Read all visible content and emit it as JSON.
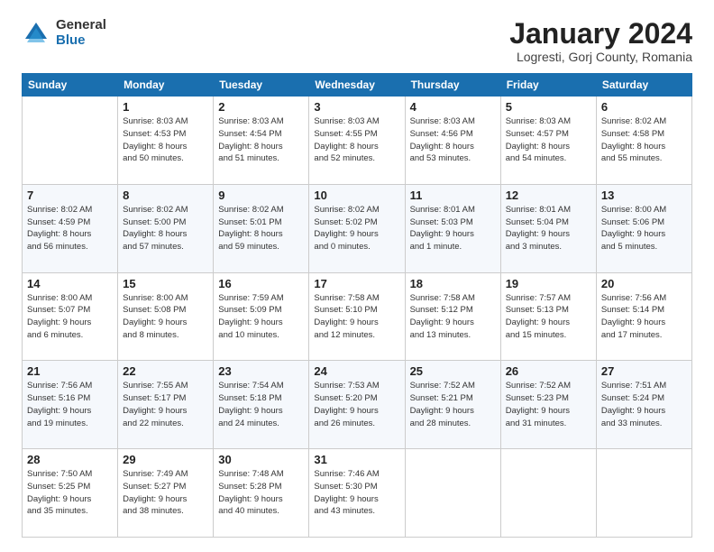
{
  "logo": {
    "general": "General",
    "blue": "Blue"
  },
  "header": {
    "month": "January 2024",
    "location": "Logresti, Gorj County, Romania"
  },
  "weekdays": [
    "Sunday",
    "Monday",
    "Tuesday",
    "Wednesday",
    "Thursday",
    "Friday",
    "Saturday"
  ],
  "weeks": [
    [
      {
        "day": "",
        "info": ""
      },
      {
        "day": "1",
        "info": "Sunrise: 8:03 AM\nSunset: 4:53 PM\nDaylight: 8 hours\nand 50 minutes."
      },
      {
        "day": "2",
        "info": "Sunrise: 8:03 AM\nSunset: 4:54 PM\nDaylight: 8 hours\nand 51 minutes."
      },
      {
        "day": "3",
        "info": "Sunrise: 8:03 AM\nSunset: 4:55 PM\nDaylight: 8 hours\nand 52 minutes."
      },
      {
        "day": "4",
        "info": "Sunrise: 8:03 AM\nSunset: 4:56 PM\nDaylight: 8 hours\nand 53 minutes."
      },
      {
        "day": "5",
        "info": "Sunrise: 8:03 AM\nSunset: 4:57 PM\nDaylight: 8 hours\nand 54 minutes."
      },
      {
        "day": "6",
        "info": "Sunrise: 8:02 AM\nSunset: 4:58 PM\nDaylight: 8 hours\nand 55 minutes."
      }
    ],
    [
      {
        "day": "7",
        "info": "Sunrise: 8:02 AM\nSunset: 4:59 PM\nDaylight: 8 hours\nand 56 minutes."
      },
      {
        "day": "8",
        "info": "Sunrise: 8:02 AM\nSunset: 5:00 PM\nDaylight: 8 hours\nand 57 minutes."
      },
      {
        "day": "9",
        "info": "Sunrise: 8:02 AM\nSunset: 5:01 PM\nDaylight: 8 hours\nand 59 minutes."
      },
      {
        "day": "10",
        "info": "Sunrise: 8:02 AM\nSunset: 5:02 PM\nDaylight: 9 hours\nand 0 minutes."
      },
      {
        "day": "11",
        "info": "Sunrise: 8:01 AM\nSunset: 5:03 PM\nDaylight: 9 hours\nand 1 minute."
      },
      {
        "day": "12",
        "info": "Sunrise: 8:01 AM\nSunset: 5:04 PM\nDaylight: 9 hours\nand 3 minutes."
      },
      {
        "day": "13",
        "info": "Sunrise: 8:00 AM\nSunset: 5:06 PM\nDaylight: 9 hours\nand 5 minutes."
      }
    ],
    [
      {
        "day": "14",
        "info": "Sunrise: 8:00 AM\nSunset: 5:07 PM\nDaylight: 9 hours\nand 6 minutes."
      },
      {
        "day": "15",
        "info": "Sunrise: 8:00 AM\nSunset: 5:08 PM\nDaylight: 9 hours\nand 8 minutes."
      },
      {
        "day": "16",
        "info": "Sunrise: 7:59 AM\nSunset: 5:09 PM\nDaylight: 9 hours\nand 10 minutes."
      },
      {
        "day": "17",
        "info": "Sunrise: 7:58 AM\nSunset: 5:10 PM\nDaylight: 9 hours\nand 12 minutes."
      },
      {
        "day": "18",
        "info": "Sunrise: 7:58 AM\nSunset: 5:12 PM\nDaylight: 9 hours\nand 13 minutes."
      },
      {
        "day": "19",
        "info": "Sunrise: 7:57 AM\nSunset: 5:13 PM\nDaylight: 9 hours\nand 15 minutes."
      },
      {
        "day": "20",
        "info": "Sunrise: 7:56 AM\nSunset: 5:14 PM\nDaylight: 9 hours\nand 17 minutes."
      }
    ],
    [
      {
        "day": "21",
        "info": "Sunrise: 7:56 AM\nSunset: 5:16 PM\nDaylight: 9 hours\nand 19 minutes."
      },
      {
        "day": "22",
        "info": "Sunrise: 7:55 AM\nSunset: 5:17 PM\nDaylight: 9 hours\nand 22 minutes."
      },
      {
        "day": "23",
        "info": "Sunrise: 7:54 AM\nSunset: 5:18 PM\nDaylight: 9 hours\nand 24 minutes."
      },
      {
        "day": "24",
        "info": "Sunrise: 7:53 AM\nSunset: 5:20 PM\nDaylight: 9 hours\nand 26 minutes."
      },
      {
        "day": "25",
        "info": "Sunrise: 7:52 AM\nSunset: 5:21 PM\nDaylight: 9 hours\nand 28 minutes."
      },
      {
        "day": "26",
        "info": "Sunrise: 7:52 AM\nSunset: 5:23 PM\nDaylight: 9 hours\nand 31 minutes."
      },
      {
        "day": "27",
        "info": "Sunrise: 7:51 AM\nSunset: 5:24 PM\nDaylight: 9 hours\nand 33 minutes."
      }
    ],
    [
      {
        "day": "28",
        "info": "Sunrise: 7:50 AM\nSunset: 5:25 PM\nDaylight: 9 hours\nand 35 minutes."
      },
      {
        "day": "29",
        "info": "Sunrise: 7:49 AM\nSunset: 5:27 PM\nDaylight: 9 hours\nand 38 minutes."
      },
      {
        "day": "30",
        "info": "Sunrise: 7:48 AM\nSunset: 5:28 PM\nDaylight: 9 hours\nand 40 minutes."
      },
      {
        "day": "31",
        "info": "Sunrise: 7:46 AM\nSunset: 5:30 PM\nDaylight: 9 hours\nand 43 minutes."
      },
      {
        "day": "",
        "info": ""
      },
      {
        "day": "",
        "info": ""
      },
      {
        "day": "",
        "info": ""
      }
    ]
  ]
}
